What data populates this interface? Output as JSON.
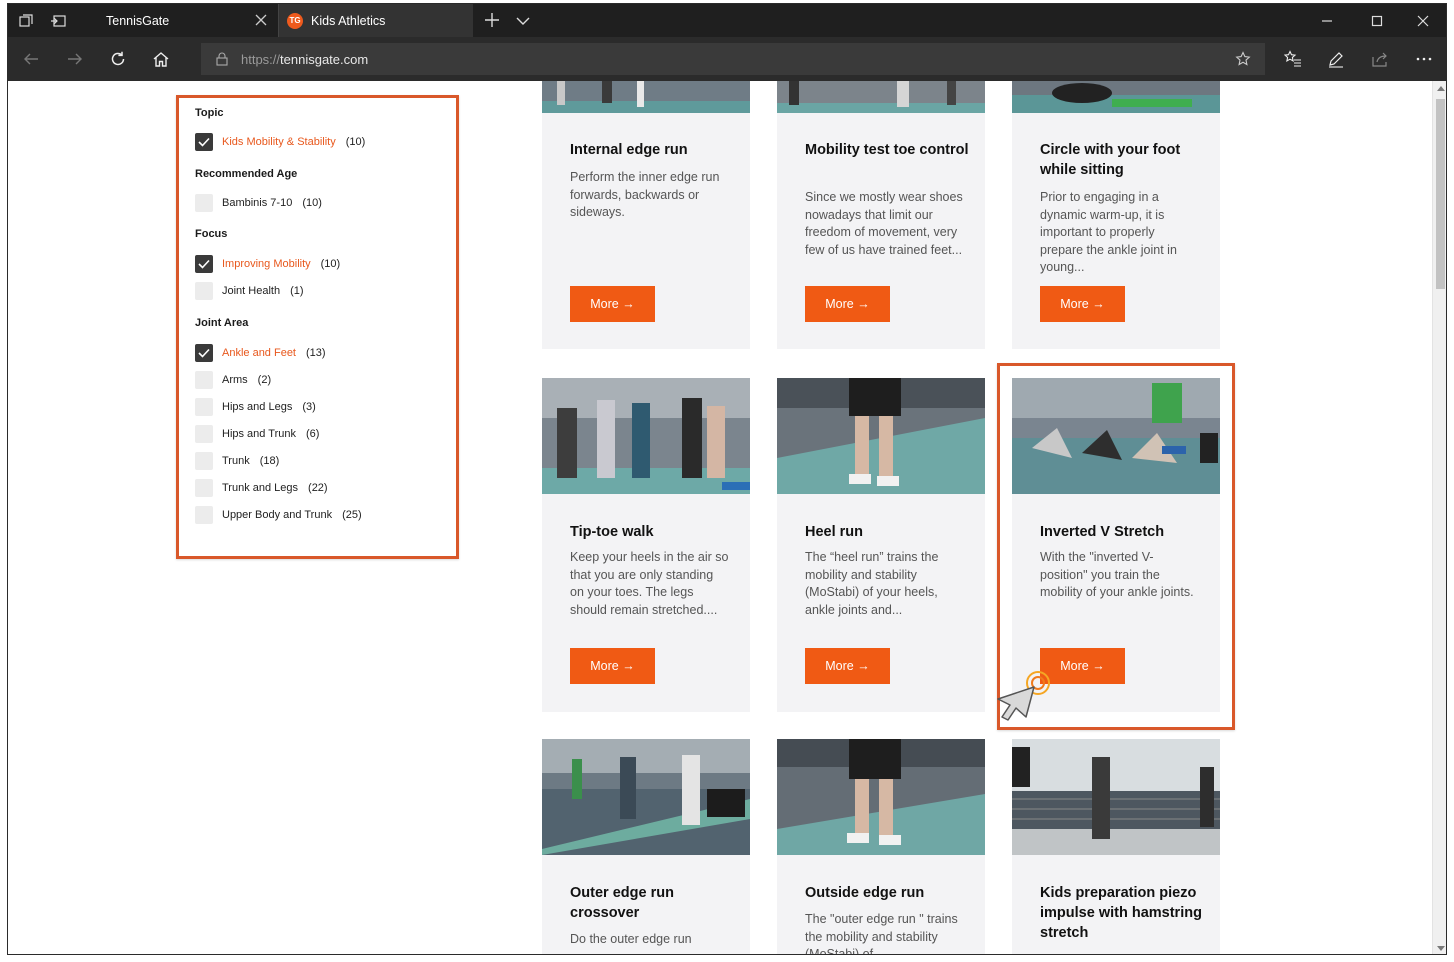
{
  "browser": {
    "tabs": [
      {
        "label": "TennisGate",
        "active": true
      },
      {
        "label": "Kids Athletics",
        "active": false,
        "favicon_text": "TG"
      }
    ],
    "url_prefix": "https://",
    "url_host": "tennisgate.com",
    "icons": {
      "back": "back-arrow-icon",
      "forward": "forward-arrow-icon",
      "refresh": "refresh-icon",
      "home": "home-icon",
      "favorite": "star-icon",
      "favorites_list": "favorites-list-icon",
      "notes": "pen-icon",
      "share": "share-icon",
      "more": "more-dots-icon"
    }
  },
  "filters": {
    "groups": [
      {
        "title": "Topic",
        "options": [
          {
            "name": "Kids Mobility & Stability",
            "count": "(10)",
            "checked": true
          }
        ]
      },
      {
        "title": "Recommended Age",
        "options": [
          {
            "name": "Bambinis 7-10",
            "count": "(10)",
            "checked": false
          }
        ]
      },
      {
        "title": "Focus",
        "options": [
          {
            "name": "Improving Mobility",
            "count": "(10)",
            "checked": true
          },
          {
            "name": "Joint Health",
            "count": "(1)",
            "checked": false
          }
        ]
      },
      {
        "title": "Joint Area",
        "options": [
          {
            "name": "Ankle and Feet",
            "count": "(13)",
            "checked": true
          },
          {
            "name": "Arms",
            "count": "(2)",
            "checked": false
          },
          {
            "name": "Hips and Legs",
            "count": "(3)",
            "checked": false
          },
          {
            "name": "Hips and Trunk",
            "count": "(6)",
            "checked": false
          },
          {
            "name": "Trunk",
            "count": "(18)",
            "checked": false
          },
          {
            "name": "Trunk and Legs",
            "count": "(22)",
            "checked": false
          },
          {
            "name": "Upper Body and Trunk",
            "count": "(25)",
            "checked": false
          }
        ]
      }
    ]
  },
  "cards": [
    {
      "title": "Internal edge run",
      "desc": "Perform the inner edge run forwards, backwards or sideways.",
      "more": "More →"
    },
    {
      "title": "Mobility test toe control",
      "desc": "Since we mostly wear shoes nowadays that limit our freedom of movement, very few of us have trained feet...",
      "more": "More →"
    },
    {
      "title": "Circle with your foot while sitting",
      "desc": "Prior to engaging in a dynamic warm-up, it is important to properly prepare the ankle joint in young...",
      "more": "More →"
    },
    {
      "title": "Tip-toe walk",
      "desc": "Keep your heels in the air so that you are only standing on your toes. The legs should remain stretched....",
      "more": "More →"
    },
    {
      "title": "Heel run",
      "desc": "The “heel run” trains the mobility and stability (MoStabi) of your heels, ankle joints and...",
      "more": "More →"
    },
    {
      "title": "Inverted V Stretch",
      "desc": "With the \"inverted V-position\" you train the mobility of your ankle joints.",
      "more": "More →"
    },
    {
      "title": "Outer edge run crossover",
      "desc": "Do the outer edge run",
      "more": ""
    },
    {
      "title": "Outside edge run",
      "desc": "The \"outer edge run \" trains the mobility and stability (MoStabi) of",
      "more": ""
    },
    {
      "title": "Kids preparation piezo impulse with hamstring stretch",
      "desc": "",
      "more": ""
    }
  ],
  "colors": {
    "accent": "#f05a14",
    "highlight_border": "#d9582a",
    "card_bg": "#f3f3f5"
  }
}
